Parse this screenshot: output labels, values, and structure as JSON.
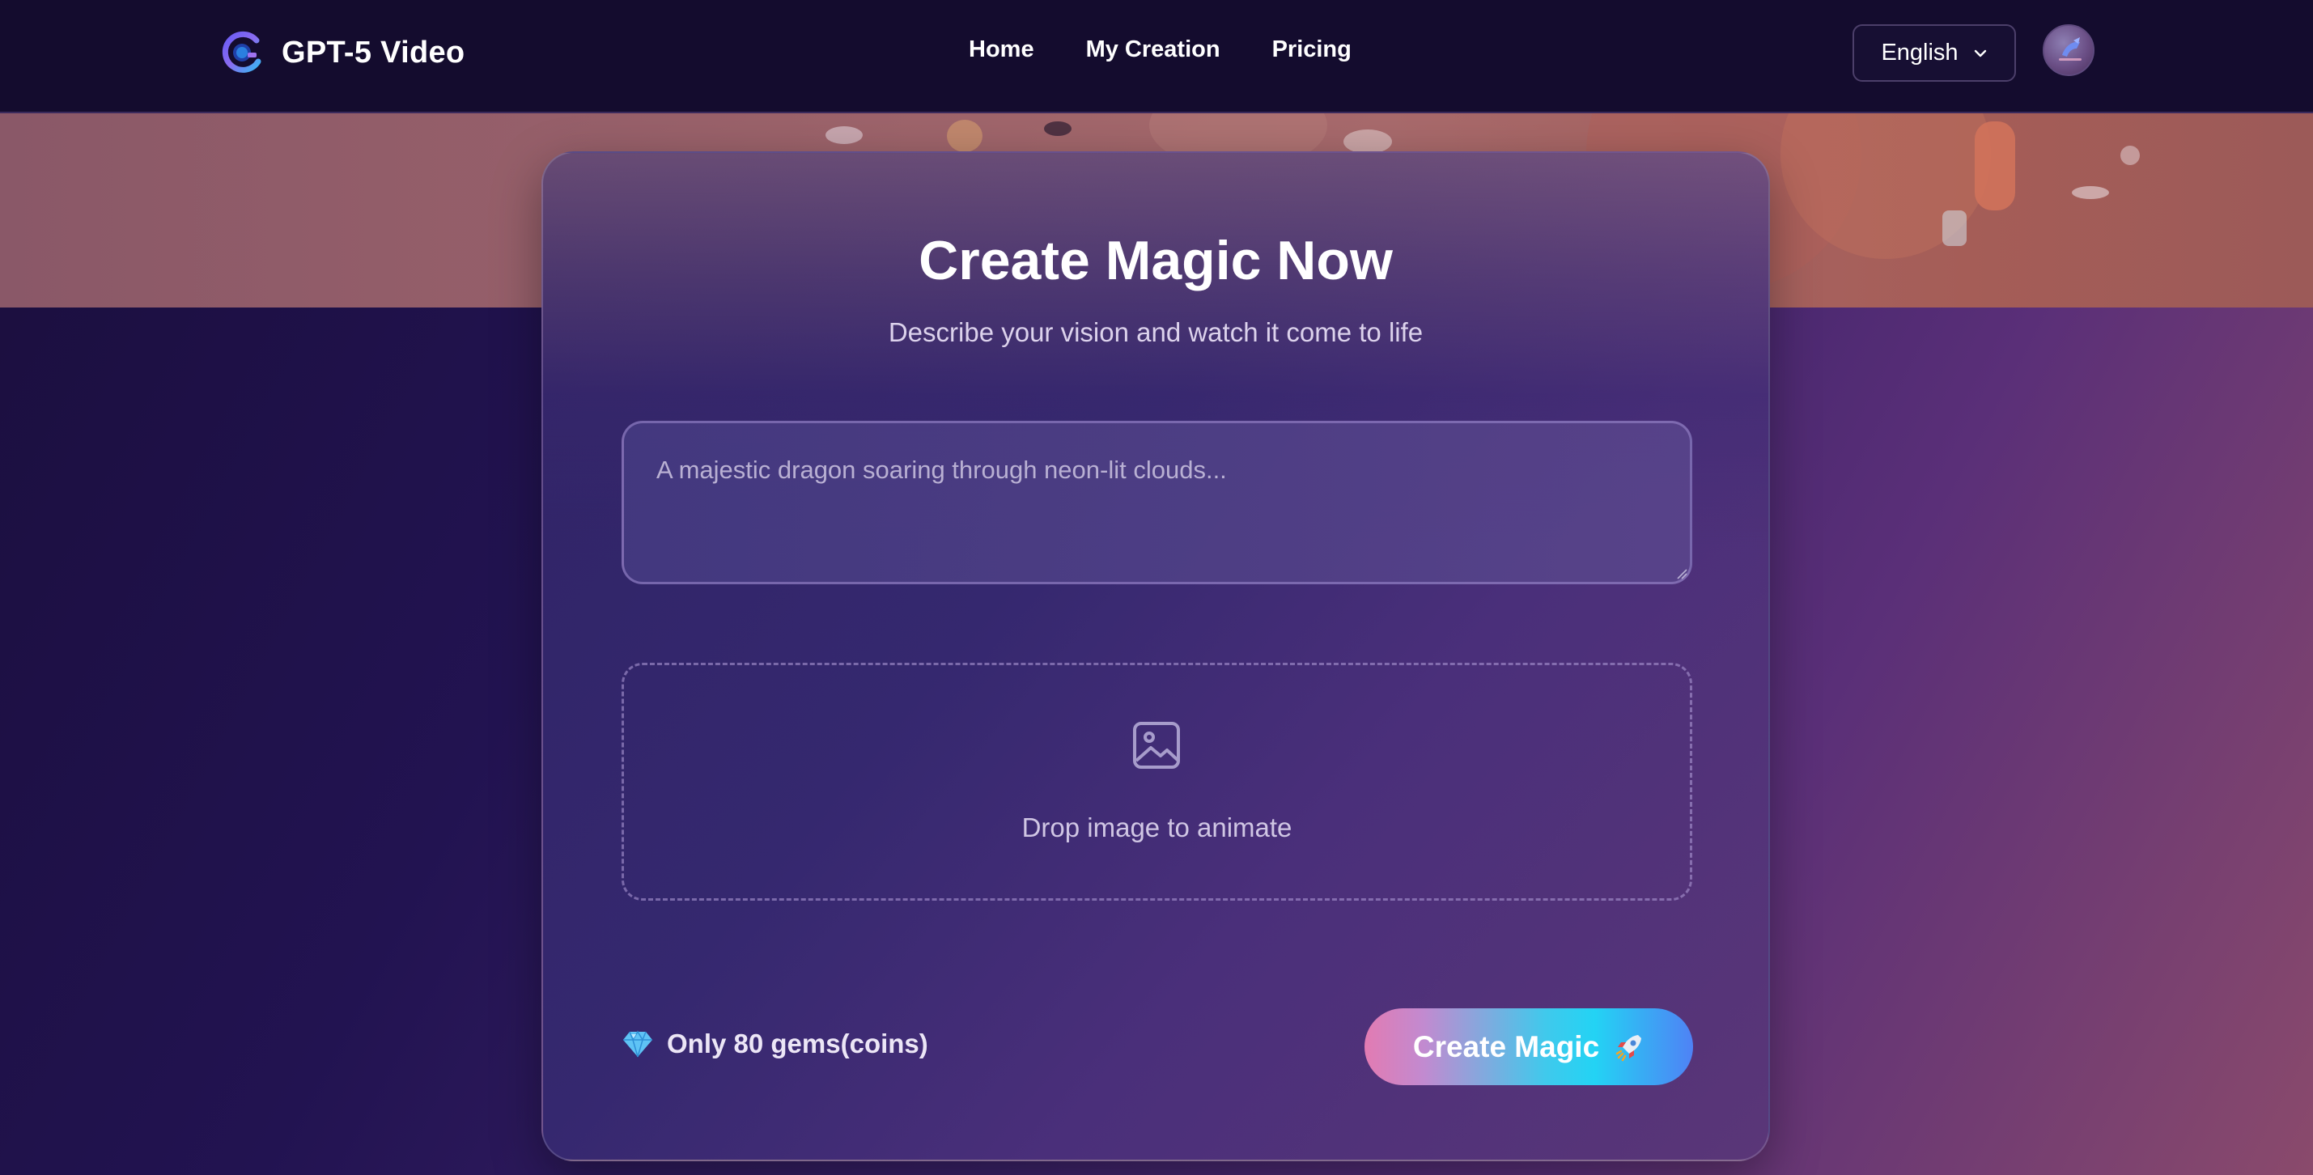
{
  "header": {
    "brand_name": "GPT-5 Video",
    "nav": [
      {
        "label": "Home"
      },
      {
        "label": "My Creation"
      },
      {
        "label": "Pricing"
      }
    ],
    "language": "English"
  },
  "card": {
    "title": "Create Magic Now",
    "subtitle": "Describe your vision and watch it come to life",
    "prompt_placeholder": "A majestic dragon soaring through neon-lit clouds...",
    "drop_label": "Drop image to animate",
    "gems_text": "Only 80 gems(coins)",
    "create_label": "Create Magic"
  },
  "icons": {
    "logo": "logo-icon",
    "language_chevron": "chevron-down-icon",
    "avatar": "user-avatar",
    "upload": "image-icon",
    "gem": "gem-icon",
    "rocket": "rocket-icon"
  },
  "colors": {
    "header_bg": "#140c2e",
    "page_gradient": [
      "#1a0e3c",
      "#3a2168",
      "#8a4a6c"
    ],
    "button_gradient": [
      "#e27bb2",
      "#23d3f4",
      "#4f82f5"
    ]
  }
}
